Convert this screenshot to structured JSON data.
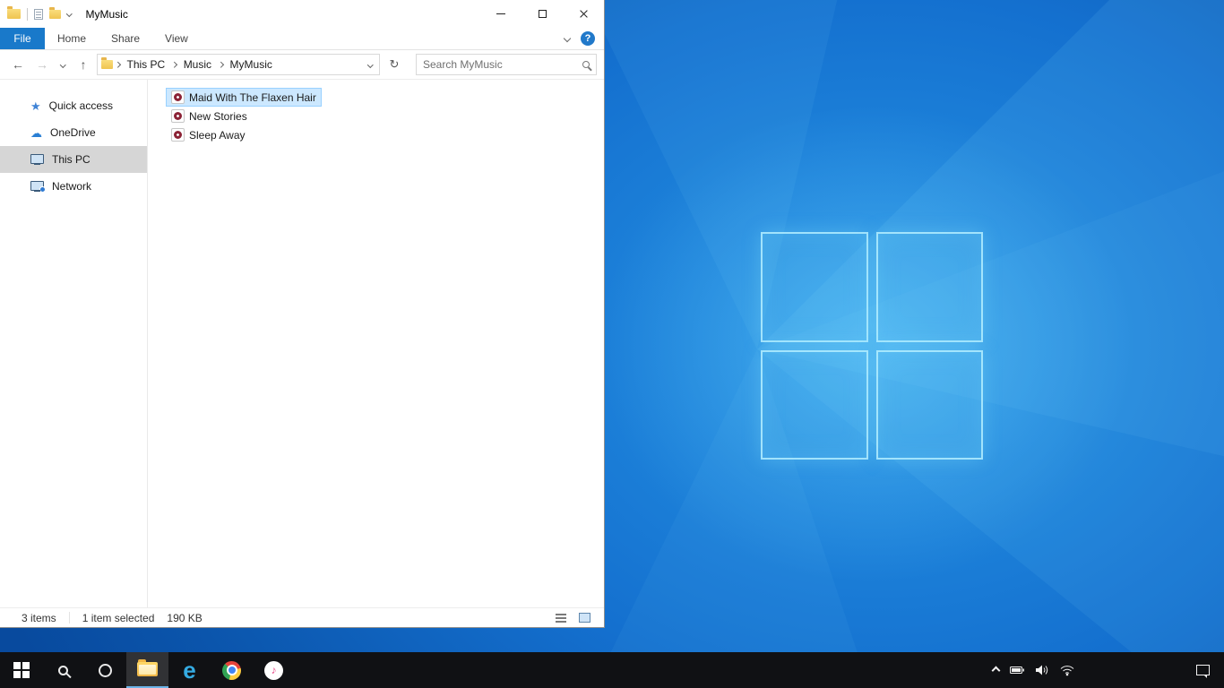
{
  "glyphs": {
    "back_arrow": "←",
    "forward_arrow": "→",
    "up_arrow": "↑",
    "refresh": "↻",
    "star": "★",
    "cloud": "☁",
    "edge_letter": "e",
    "itunes_note": "♪",
    "help": "?"
  },
  "window": {
    "title": "MyMusic",
    "ribbon": {
      "file_tab": "File",
      "tabs": [
        {
          "label": "Home"
        },
        {
          "label": "Share"
        },
        {
          "label": "View"
        }
      ]
    },
    "address": {
      "breadcrumb": [
        {
          "label": "This PC"
        },
        {
          "label": "Music"
        },
        {
          "label": "MyMusic"
        }
      ],
      "search_placeholder": "Search MyMusic"
    },
    "sidebar": {
      "items": [
        {
          "label": "Quick access"
        },
        {
          "label": "OneDrive"
        },
        {
          "label": "This PC"
        },
        {
          "label": "Network"
        }
      ]
    },
    "files": [
      {
        "name": "Maid With The Flaxen Hair"
      },
      {
        "name": "New Stories"
      },
      {
        "name": "Sleep Away"
      }
    ],
    "statusbar": {
      "items_count": "3 items",
      "selection_count": "1 item selected",
      "selection_size": "190 KB"
    }
  },
  "taskbar": {
    "buttons": [
      {
        "name": "start"
      },
      {
        "name": "search"
      },
      {
        "name": "cortana"
      },
      {
        "name": "file-explorer",
        "active": true
      },
      {
        "name": "edge"
      },
      {
        "name": "chrome"
      },
      {
        "name": "itunes"
      }
    ],
    "tray": [
      {
        "name": "hidden-icons-chevron"
      },
      {
        "name": "battery"
      },
      {
        "name": "volume"
      },
      {
        "name": "network"
      },
      {
        "name": "action-center"
      }
    ]
  },
  "colors": {
    "accent": "#1979ca",
    "selection_bg": "#cce8ff",
    "selection_border": "#99d1ff",
    "sidebar_selected_bg": "#d6d6d6",
    "taskbar_bg": "#101114"
  }
}
